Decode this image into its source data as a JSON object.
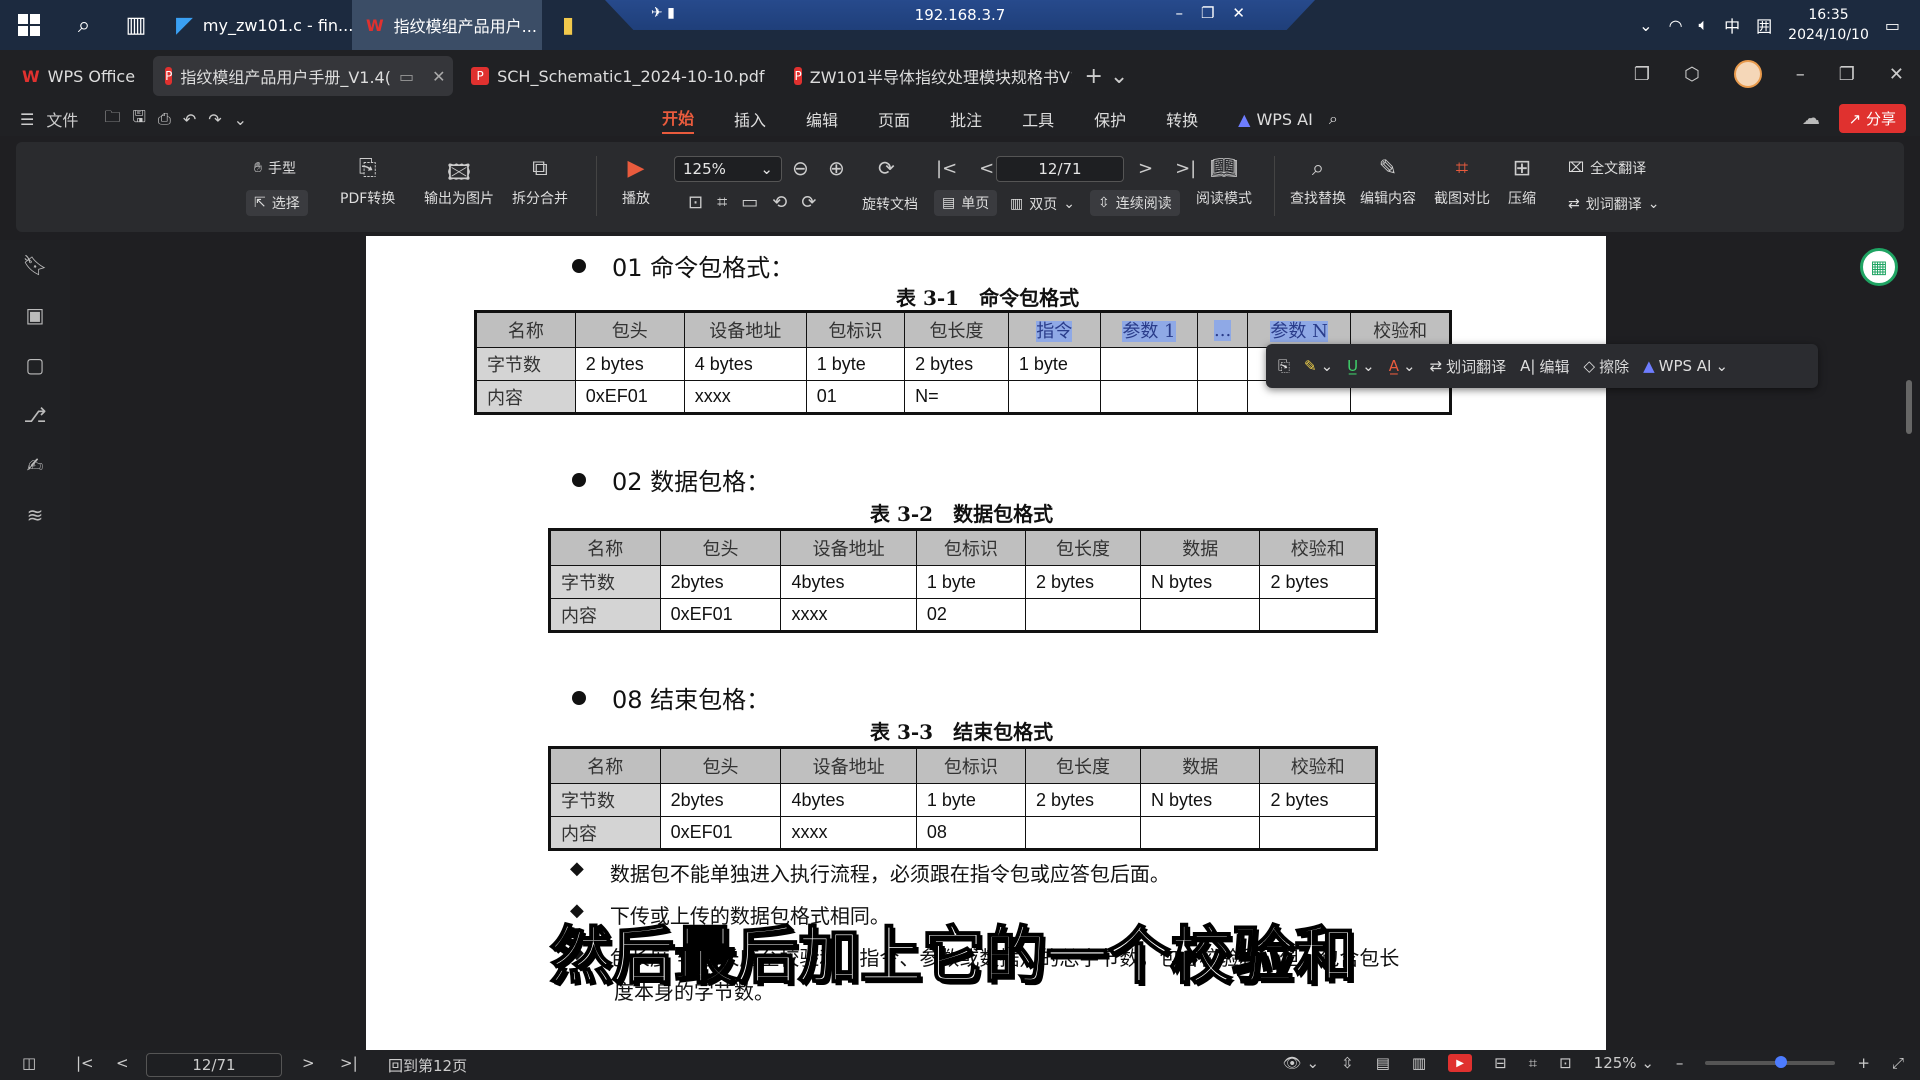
{
  "taskbar": {
    "apps": [
      {
        "label": "my_zw101.c - fin..."
      },
      {
        "label": "指纹模组产品用户..."
      }
    ],
    "remote_ip": "192.168.3.7",
    "ime": "中",
    "time": "16:35",
    "date": "2024/10/10"
  },
  "wps_tabs": [
    {
      "label": "WPS Office"
    },
    {
      "label": "指纹模组产品用户手册_V1.4("
    },
    {
      "label": "SCH_Schematic1_2024-10-10.pdf"
    },
    {
      "label": "ZW101半导体指纹处理模块规格书V1"
    }
  ],
  "menu": {
    "file": "文件",
    "tabs": [
      "开始",
      "插入",
      "编辑",
      "页面",
      "批注",
      "工具",
      "保护",
      "转换"
    ],
    "active": "开始",
    "wps_ai": "WPS AI",
    "share": "分享"
  },
  "toolbar": {
    "hand": "手型",
    "select": "选择",
    "pdf_convert": "PDF转换",
    "export_image": "输出为图片",
    "split_merge": "拆分合并",
    "play": "播放",
    "zoom": "125%",
    "rotate": "旋转文档",
    "single": "单页",
    "double": "双页",
    "continuous": "连续阅读",
    "page": "12/71",
    "read_mode": "阅读模式",
    "find_replace": "查找替换",
    "edit_content": "编辑内容",
    "compare": "截图对比",
    "compress": "压缩",
    "full_translate": "全文翻译",
    "word_translate": "划词翻译"
  },
  "doc": {
    "s1_title": "01 命令包格式：",
    "t1_caption": "表 3-1　命令包格式",
    "t1_header": [
      "名称",
      "包头",
      "设备地址",
      "包标识",
      "包长度",
      "指令",
      "参数 1",
      "...",
      "参数 N",
      "校验和"
    ],
    "t1_row1": [
      "字节数",
      "2 bytes",
      "4 bytes",
      "1 byte",
      "2 bytes",
      "1 byte"
    ],
    "t1_row2": [
      "内容",
      "0xEF01",
      "xxxx",
      "01",
      "N="
    ],
    "s2_title": "02 数据包格：",
    "t2_caption": "表 3-2　数据包格式",
    "t2_header": [
      "名称",
      "包头",
      "设备地址",
      "包标识",
      "包长度",
      "数据",
      "校验和"
    ],
    "t2_row1": [
      "字节数",
      "2bytes",
      "4bytes",
      "1 byte",
      "2 bytes",
      "N bytes",
      "2 bytes"
    ],
    "t2_row2": [
      "内容",
      "0xEF01",
      "xxxx",
      "02"
    ],
    "s3_title": "08 结束包格：",
    "t3_caption": "表 3-3　结束包格式",
    "t3_header": [
      "名称",
      "包头",
      "设备地址",
      "包标识",
      "包长度",
      "数据",
      "校验和"
    ],
    "t3_row1": [
      "字节数",
      "2bytes",
      "4bytes",
      "1 byte",
      "2 bytes",
      "N bytes",
      "2 bytes"
    ],
    "t3_row2": [
      "内容",
      "0xEF01",
      "xxxx",
      "08"
    ],
    "note1": "数据包不能单独进入执行流程，必须跟在指令包或应答包后面。",
    "note2": "下传或上传的数据包格式相同。",
    "note3": "包长度 = 包长度至校验和（指令、参数或数据）的总字节数，包含校验和，但不包含包长",
    "note3b": "度本身的字节数。"
  },
  "float_bar": {
    "translate": "划词翻译",
    "edit": "编辑",
    "erase": "擦除",
    "wps_ai": "WPS AI"
  },
  "subtitle": "然后最后加上它的一个校验和",
  "status": {
    "page": "12/71",
    "back": "回到第12页",
    "zoom": "125%"
  }
}
